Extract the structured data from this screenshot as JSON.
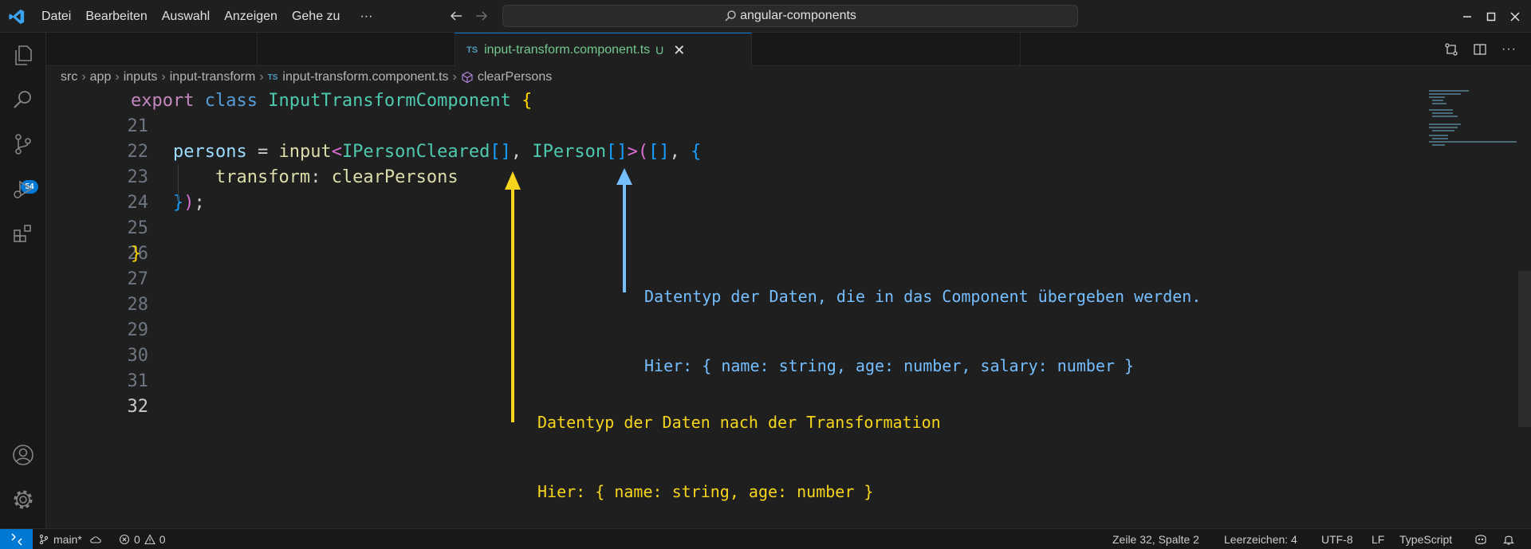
{
  "menu": {
    "items": [
      "Datei",
      "Bearbeiten",
      "Auswahl",
      "Anzeigen",
      "Gehe zu"
    ],
    "more": "···"
  },
  "search": {
    "text": "angular-components"
  },
  "activity": {
    "source_control_badge": "54"
  },
  "tab": {
    "lang_badge": "TS",
    "filename": "input-transform.component.ts",
    "status": "U"
  },
  "breadcrumb": [
    "src",
    "app",
    "inputs",
    "input-transform",
    "input-transform.component.ts",
    "clearPersons"
  ],
  "editor": {
    "line_numbers": [
      "21",
      "22",
      "23",
      "24",
      "25",
      "26",
      "27",
      "28",
      "29",
      "30",
      "31",
      "32"
    ],
    "current_line": "32",
    "line21": {
      "export": "export",
      "class": "class",
      "name": "InputTransformComponent",
      "brace": "{"
    },
    "line23": {
      "prop": "persons",
      "eq": " = ",
      "fn": "input",
      "lt": "<",
      "t1": "IPersonCleared",
      "arr1": "[]",
      "comma": ", ",
      "t2": "IPerson",
      "arr2": "[]",
      "gt": ">",
      "open": "(",
      "arr3": "[]",
      "comma2": ", ",
      "brace": "{"
    },
    "line24": {
      "key": "transform",
      "colon": ": ",
      "value": "clearPersons"
    },
    "line25": {
      "brace": "}",
      "paren": ")",
      "semi": ";"
    },
    "line27": {
      "brace": "}"
    }
  },
  "annotations": {
    "blue": {
      "line1": "Datentyp der Daten, die in das Component übergeben werden.",
      "line2": "Hier: { name: string, age: number, salary: number }",
      "color": "#75beff"
    },
    "yellow": {
      "line1": "Datentyp der Daten nach der Transformation",
      "line2": "Hier: { name: string, age: number }",
      "color": "#f7d51d"
    }
  },
  "statusbar": {
    "branch": "main*",
    "errors": "0",
    "warnings": "0",
    "position": "Zeile 32, Spalte 2",
    "spaces": "Leerzeichen: 4",
    "encoding": "UTF-8",
    "eol": "LF",
    "language": "TypeScript"
  }
}
